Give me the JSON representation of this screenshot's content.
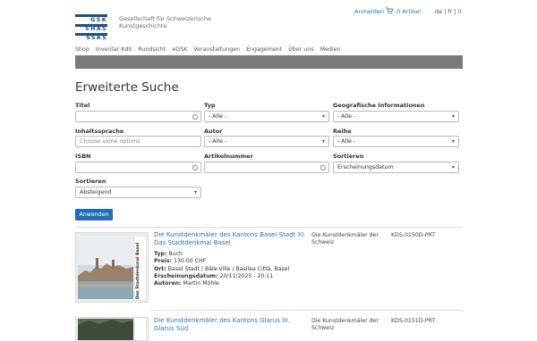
{
  "header": {
    "logo_lines": [
      "GSK",
      "SHAS",
      "SSAS"
    ],
    "org_name": "Gesellschaft für Schweizerische Kunstgeschichte",
    "login": "Anmelden",
    "cart": "0 Artikel",
    "languages": [
      "de",
      "fr",
      "it"
    ],
    "active_language": "it"
  },
  "nav": [
    "Shop",
    "Inventar KdS",
    "Rundsicht",
    "eGSK",
    "Veranstaltungen",
    "Engagement",
    "Über uns",
    "Medien"
  ],
  "page_title": "Erweiterte Suche",
  "form": {
    "titel_label": "Titel",
    "typ_label": "Typ",
    "typ_value": "- Alle -",
    "geo_label": "Geografische Informationen",
    "geo_value": "- Alle -",
    "inhalt_label": "Inhaltssprache",
    "inhalt_placeholder": "Choose some options",
    "autor_label": "Autor",
    "autor_value": "- Alle -",
    "reihe_label": "Reihe",
    "reihe_value": "- Alle -",
    "isbn_label": "ISBN",
    "artikel_label": "Artikelnummer",
    "sort1_label": "Sortieren",
    "sort1_value": "Erscheinungsdatum",
    "sort2_label": "Sortieren",
    "sort2_value": "Absteigend",
    "submit": "Anwenden"
  },
  "results": [
    {
      "title": "Die Kunstdenkmäler des Kantons Basel-Stadt XI. Das Stadtdenkmal Basel",
      "spine_text": "Das Stadtdenkmal Basel",
      "typ_label": "Typ:",
      "typ": "Buch",
      "preis_label": "Preis:",
      "preis": "130.00 CHF",
      "ort_label": "Ort:",
      "ort": "Basel Stadt / Bâle-Ville / Basilea Città, Basel",
      "datum_label": "Erscheinungsdatum:",
      "datum": "20/11/2025 - 20:11",
      "autoren_label": "Autoren:",
      "autoren": "Martin Möhle",
      "series": "Die Kunstdenkmäler der Schweiz",
      "code": "KDS-0150D-PRT"
    },
    {
      "title": "Die Kunstdenkmäler des Kantons Glarus III. Glarus Süd",
      "series": "Die Kunstdenkmäler der Schweiz",
      "code": "KDS-0151D-PRT"
    }
  ]
}
